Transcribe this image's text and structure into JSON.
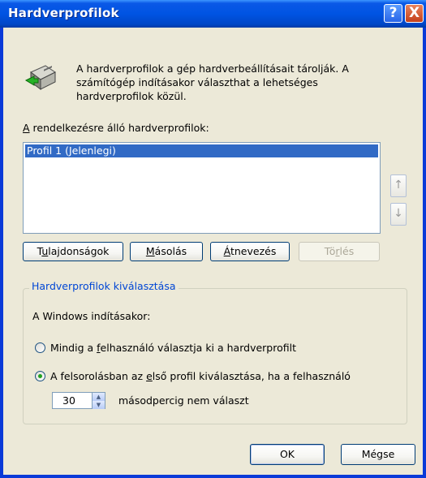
{
  "window": {
    "title": "Hardverprofilok"
  },
  "titlebar_buttons": {
    "help": "?",
    "close": "X"
  },
  "intro": {
    "line1": "A hardverprofilok a gép hardverbeállításait tárolják.  A",
    "line2": "számítógép indításakor választhat a lehetséges",
    "line3": "hardverprofilok közül."
  },
  "profiles": {
    "label_accel": "A",
    "label_rest": " rendelkezésre álló hardverprofilok:",
    "items": [
      "Profil 1 (Jelenlegi)"
    ]
  },
  "arrows": {
    "up": "↑",
    "down": "↓"
  },
  "buttons": {
    "properties_a": "T",
    "properties_b": "u",
    "properties_c": "lajdonságok",
    "copy_a": "M",
    "copy_b": "ásolás",
    "rename_a": "Á",
    "rename_b": "tnevezés",
    "delete_a": "Tö",
    "delete_b": "r",
    "delete_c": "lés",
    "ok": "OK",
    "cancel": "Mégse"
  },
  "selection_group": {
    "title": "Hardverprofilok kiválasztása",
    "startup_label": "A Windows indításakor:",
    "option1_a": "Mindig a ",
    "option1_b": "f",
    "option1_c": "elhasználó választja ki a hardverprofilt",
    "option2_a": "A felsorolásban az  ",
    "option2_b": "e",
    "option2_c": "lső profil kiválasztása, ha a felhasználó",
    "selected_option": 2,
    "seconds_value": "30",
    "seconds_suffix": "másodpercig nem választ"
  }
}
